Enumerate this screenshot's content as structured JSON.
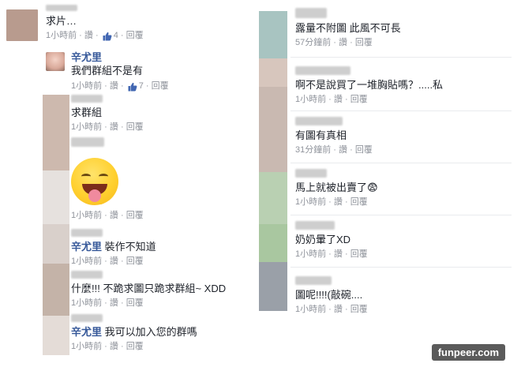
{
  "left": {
    "comments": [
      {
        "name": "",
        "text": "求片…",
        "time": "1小時前",
        "like": "讚",
        "likes": "4",
        "reply": "回覆"
      },
      {
        "name": "辛尤里",
        "text": "我們群組不是有",
        "time": "1小時前",
        "like": "讚",
        "likes": "7",
        "reply": "回覆"
      },
      {
        "name": "",
        "text": "求群組",
        "time": "1小時前",
        "like": "讚",
        "reply": "回覆"
      },
      {
        "name": "",
        "text": "",
        "time": "1小時前",
        "like": "讚",
        "reply": "回覆"
      },
      {
        "name": "辛尤里",
        "text": "裝作不知道",
        "time": "1小時前",
        "like": "讚",
        "reply": "回覆"
      },
      {
        "name": "",
        "text": "什麼!!! 不跪求圖只跪求群組~ XDD",
        "time": "1小時前",
        "like": "讚",
        "reply": "回覆"
      },
      {
        "name": "辛尤里",
        "text": "我可以加入您的群嗎",
        "time": "1小時前",
        "like": "讚",
        "reply": "回覆"
      }
    ]
  },
  "right": {
    "comments": [
      {
        "text": "露量不附圖 此風不可長",
        "time": "57分鐘前",
        "like": "讚",
        "reply": "回覆"
      },
      {
        "text": "啊不是說買了一堆胸貼嗎？.....私",
        "time": "1小時前",
        "like": "讚",
        "reply": "回覆"
      },
      {
        "text": "有圖有真相",
        "time": "31分鐘前",
        "like": "讚",
        "reply": "回覆"
      },
      {
        "text": "馬上就被出賣了😨",
        "time": "1小時前",
        "like": "讚",
        "reply": "回覆"
      },
      {
        "text": "奶奶暈了XD",
        "time": "1小時前",
        "like": "讚",
        "reply": "回覆"
      },
      {
        "text": "圖呢!!!!(敲碗....",
        "time": "1小時前",
        "like": "讚",
        "reply": "回覆"
      }
    ]
  },
  "watermark": "funpeer.com",
  "colors": {
    "link": "#365899",
    "meta": "#90949c"
  }
}
